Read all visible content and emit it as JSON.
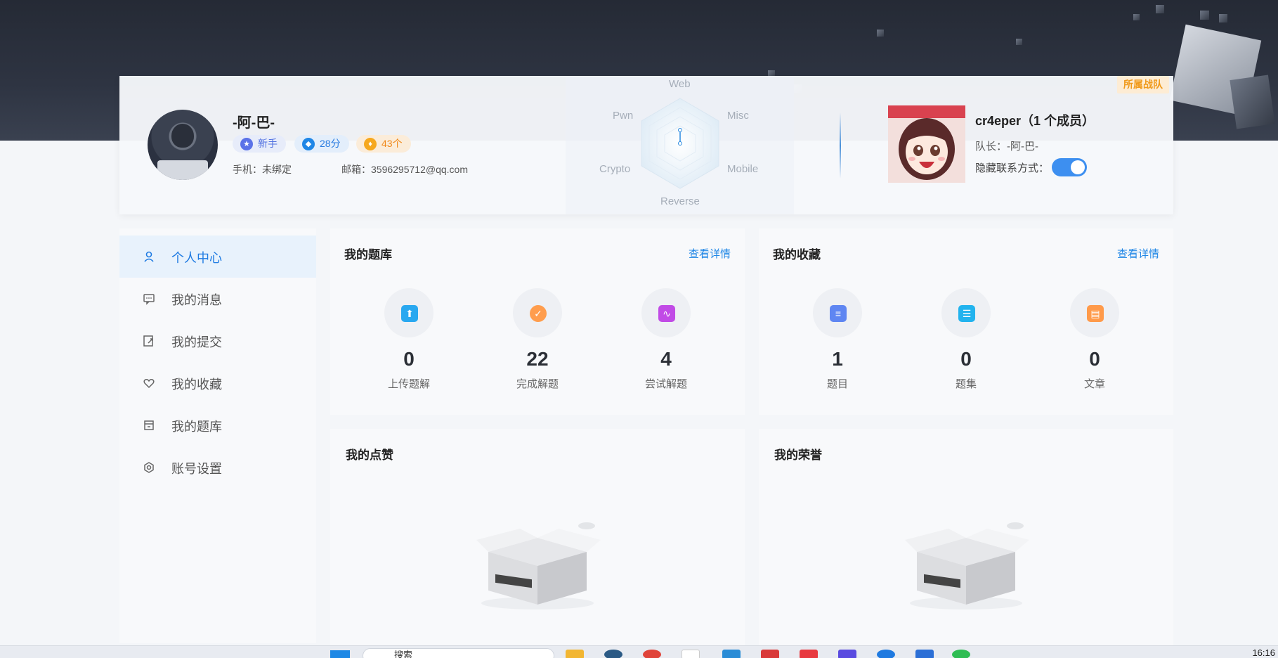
{
  "user": {
    "name": "-阿-巴-",
    "level_badge": "新手",
    "score_badge": "28分",
    "coin_badge": "43个",
    "phone": "手机：未绑定",
    "email": "邮箱：3596295712@qq.com"
  },
  "radar": {
    "labels": {
      "web": "Web",
      "misc": "Misc",
      "mobile": "Mobile",
      "reverse": "Reverse",
      "crypto": "Crypto",
      "pwn": "Pwn"
    }
  },
  "team": {
    "tag": "所属战队",
    "name": "cr4eper（1 个成员）",
    "leader": "队长：-阿-巴-",
    "hide_contact_label": "隐藏联系方式：",
    "hide_contact_on": true
  },
  "sidebar": {
    "items": [
      {
        "label": "个人中心",
        "icon": "user-icon",
        "active": true
      },
      {
        "label": "我的消息",
        "icon": "message-icon"
      },
      {
        "label": "我的提交",
        "icon": "submit-icon"
      },
      {
        "label": "我的收藏",
        "icon": "heart-icon"
      },
      {
        "label": "我的题库",
        "icon": "bank-icon"
      },
      {
        "label": "账号设置",
        "icon": "settings-icon"
      }
    ]
  },
  "question_bank": {
    "title": "我的题库",
    "link": "查看详情",
    "stats": [
      {
        "value": "0",
        "label": "上传题解",
        "icon": "upload-icon",
        "color": "#29a8f0"
      },
      {
        "value": "22",
        "label": "完成解题",
        "icon": "check-icon",
        "color": "#ff9d4d"
      },
      {
        "value": "4",
        "label": "尝试解题",
        "icon": "pulse-icon",
        "color": "#c14be6"
      }
    ]
  },
  "favorites": {
    "title": "我的收藏",
    "link": "查看详情",
    "stats": [
      {
        "value": "1",
        "label": "题目",
        "icon": "document-icon",
        "color": "#5f86f2"
      },
      {
        "value": "0",
        "label": "题集",
        "icon": "set-icon",
        "color": "#22b3ee"
      },
      {
        "value": "0",
        "label": "文章",
        "icon": "article-icon",
        "color": "#ff9a4a"
      }
    ]
  },
  "likes": {
    "title": "我的点赞"
  },
  "honors": {
    "title": "我的荣誉"
  },
  "taskbar": {
    "search_placeholder": "搜索",
    "clock": "16:16"
  }
}
